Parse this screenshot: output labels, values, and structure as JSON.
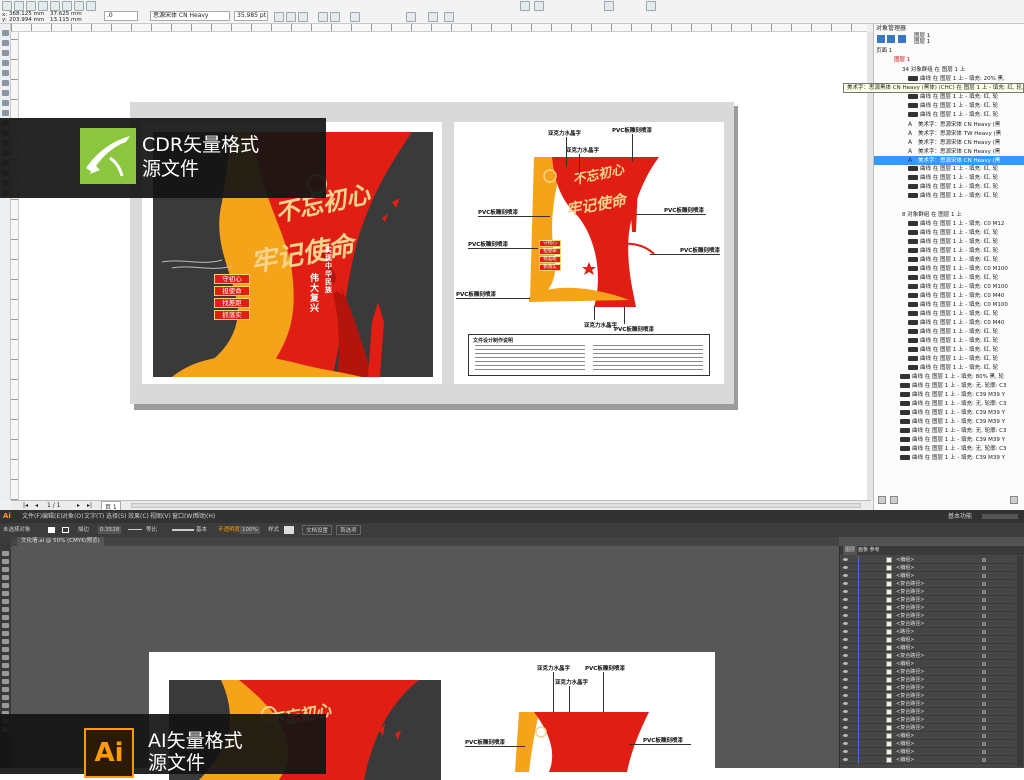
{
  "cdr": {
    "toolbar": {
      "x_value": "368.125 mm",
      "y_value": "203.994 mm",
      "w_value": "37.625 mm",
      "h_value": "13.115 mm",
      "angle_value": ".0",
      "font_name": "思源宋体 CN Heavy",
      "font_size": "35.985 pt"
    },
    "page_nav": {
      "current": "1 / 1",
      "page_tab": "页 1"
    },
    "design": {
      "calligraphy_1": "不忘初心",
      "calligraphy_2": "牢记使命",
      "chip_labels": [
        "守初心",
        "担使命",
        "找差距",
        "抓落实"
      ],
      "vertical_1": "实现中华民族",
      "vertical_2": "伟大复兴",
      "callouts": [
        "亚克力水晶字",
        "PVC板雕刻喷漆",
        "亚克力水晶字",
        "PVC板雕刻喷漆",
        "PVC板雕刻喷漆",
        "PVC板雕刻喷漆",
        "PVC板雕刻喷漆",
        "亚克力水晶字",
        "PVC板雕刻喷漆"
      ],
      "notes_title": "文件设计制作说明"
    },
    "object_manager": {
      "title": "对象管理器",
      "layer1": "图层 1",
      "layer2": "图层 1",
      "page": "页面 1",
      "layer_node": "图层 1",
      "group_header_1": "34 对象群组 在 图层 1 上",
      "group_header_2": "8 对象群组 在 图层 1 上",
      "tooltip": "美术字：思源黑体 CN Heavy (黑体) (CHC) 在 图层 1 上 - 填充: 红, 轮...",
      "rows": [
        "曲线 在 图层 1 上 - 填充: 20% 黑,",
        "美术字：思源黑体 CN Heavy (黑",
        "曲线 在 图层 1 上 - 填充: 红, 轮",
        "曲线 在 图层 1 上 - 填充: 红, 轮",
        "曲线 在 图层 1 上 - 填充: 红, 轮",
        "美术字：思源宋体 CN Heavy (黑",
        "美术字：思源宋体 TW Heavy (黑",
        "美术字：思源宋体 CN Heavy (黑",
        "美术字：思源宋体 CN Heavy (黑",
        "美术字：思源宋体 CN Heavy (黑",
        "曲线 在 图层 1 上 - 填充: 红, 轮",
        "曲线 在 图层 1 上 - 填充: 红, 轮",
        "曲线 在 图层 1 上 - 填充: 红, 轮",
        "曲线 在 图层 1 上 - 填充: 红, 轮"
      ],
      "rows_2": [
        "曲线 在 图层 1 上 - 填充: C0 M12",
        "曲线 在 图层 1 上 - 填充: 红, 轮",
        "曲线 在 图层 1 上 - 填充: 红, 轮",
        "曲线 在 图层 1 上 - 填充: 红, 轮",
        "曲线 在 图层 1 上 - 填充: 红, 轮",
        "曲线 在 图层 1 上 - 填充: C0 M100",
        "曲线 在 图层 1 上 - 填充: 红, 轮",
        "曲线 在 图层 1 上 - 填充: C0 M100",
        "曲线 在 图层 1 上 - 填充: C0 M40",
        "曲线 在 图层 1 上 - 填充: C0 M100",
        "曲线 在 图层 1 上 - 填充: 红, 轮",
        "曲线 在 图层 1 上 - 填充: C0 M40",
        "曲线 在 图层 1 上 - 填充: 红, 轮",
        "曲线 在 图层 1 上 - 填充: 红, 轮",
        "曲线 在 图层 1 上 - 填充: 红, 轮",
        "曲线 在 图层 1 上 - 填充: 红, 轮",
        "曲线 在 图层 1 上 - 填充: 红, 轮"
      ],
      "rows_3": [
        "曲线 在 图层 1 上 - 填充: 80% 黑, 轮",
        "曲线 在 图层 1 上 - 填充: 无, 轮廓: C3",
        "曲线 在 图层 1 上 - 填充: C39 M39 Y",
        "曲线 在 图层 1 上 - 填充: 无, 轮廓: C3",
        "曲线 在 图层 1 上 - 填充: C39 M39 Y",
        "曲线 在 图层 1 上 - 填充: C39 M39 Y",
        "曲线 在 图层 1 上 - 填充: 无, 轮廓: C3",
        "曲线 在 图层 1 上 - 填充: C39 M39 Y",
        "曲线 在 图层 1 上 - 填充: 无, 轮廓: C3",
        "曲线 在 图层 1 上 - 填充: C39 M39 Y"
      ]
    },
    "badge": {
      "title_line1": "CDR矢量格式",
      "title_line2": "源文件"
    }
  },
  "ai": {
    "logo": "Ai",
    "menu": [
      "文件(F)",
      "编辑(E)",
      "对象(O)",
      "文字(T)",
      "选择(S)",
      "效果(C)",
      "视图(V)",
      "窗口(W)",
      "帮助(H)"
    ],
    "workspace": "基本功能",
    "control": {
      "selection": "未选择对象",
      "stroke_label": "描边",
      "stroke_value": "0.3528",
      "uniform": "等比",
      "basic": "基本",
      "opacity_label": "不透明度",
      "opacity_value": "100%",
      "style_label": "样式",
      "doc_setup": "文档设置",
      "prefs": "首选项"
    },
    "doc_tab": "文化墙.ai @ 50% (CMYK/预览)",
    "layers_tabs": [
      "图层",
      "画板 参考"
    ],
    "layer_rows": [
      "<编组>",
      "<编组>",
      "<编组>",
      "<复合路径>",
      "<复合路径>",
      "<复合路径>",
      "<复合路径>",
      "<复合路径>",
      "<复合路径>",
      "<路径>",
      "<编组>",
      "<编组>",
      "<复合路径>",
      "<编组>",
      "<复合路径>",
      "<复合路径>",
      "<复合路径>",
      "<复合路径>",
      "<复合路径>",
      "<复合路径>",
      "<复合路径>",
      "<复合路径>",
      "<编组>",
      "<编组>",
      "<编组>",
      "<编组>"
    ],
    "design_callouts": [
      "亚克力水晶字",
      "PVC板雕刻喷漆",
      "亚克力水晶字",
      "PVC板雕刻喷漆",
      "PVC板雕刻喷漆"
    ],
    "badge": {
      "logo": "Ai",
      "title_line1": "AI矢量格式",
      "title_line2": "源文件"
    }
  },
  "colors": {
    "red": "#e11e14",
    "orange": "#f5a318",
    "dark": "#3a3a3a",
    "cdr_green": "#8cc63f",
    "ai_orange": "#ff9a00"
  }
}
